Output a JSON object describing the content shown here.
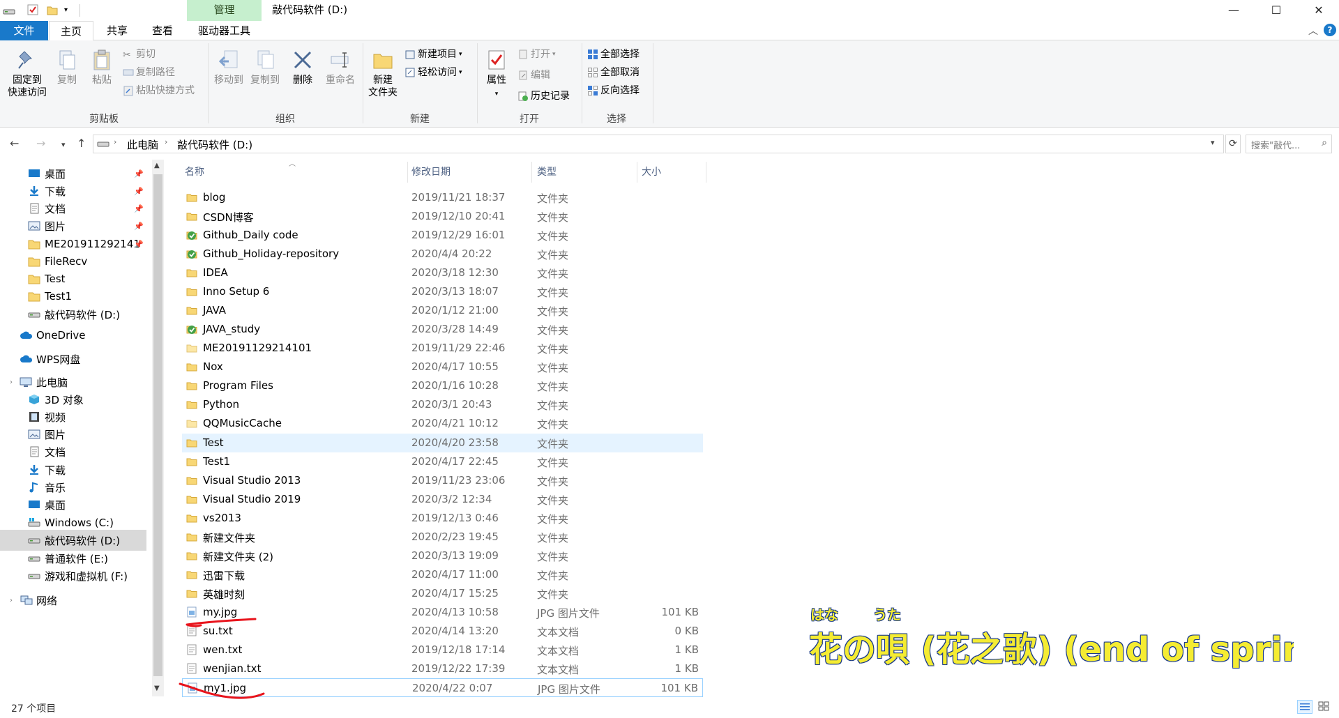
{
  "window": {
    "title": "敲代码软件 (D:)",
    "context_tab": "管理",
    "controls": {
      "minimize": "—",
      "maximize": "☐",
      "close": "✕"
    }
  },
  "tabs": {
    "file": "文件",
    "home": "主页",
    "share": "共享",
    "view": "查看",
    "drive": "驱动器工具"
  },
  "ribbon": {
    "clipboard": {
      "pin_line1": "固定到",
      "pin_line2": "快速访问",
      "copy": "复制",
      "paste": "粘贴",
      "cut": "剪切",
      "copy_path": "复制路径",
      "paste_shortcut": "粘贴快捷方式",
      "label": "剪贴板"
    },
    "organize": {
      "move_to": "移动到",
      "copy_to": "复制到",
      "delete": "删除",
      "rename": "重命名",
      "label": "组织"
    },
    "new": {
      "new_folder_line1": "新建",
      "new_folder_line2": "文件夹",
      "new_item": "新建项目",
      "easy_access": "轻松访问",
      "label": "新建"
    },
    "open": {
      "properties": "属性",
      "open": "打开",
      "edit": "编辑",
      "history": "历史记录",
      "label": "打开"
    },
    "select": {
      "select_all": "全部选择",
      "select_none": "全部取消",
      "invert": "反向选择",
      "label": "选择"
    }
  },
  "address": {
    "crumb1": "此电脑",
    "crumb2": "敲代码软件 (D:)",
    "search_placeholder": "搜索\"敲代..."
  },
  "nav": {
    "items": [
      {
        "label": "桌面",
        "icon": "desktop-icon",
        "pinned": true
      },
      {
        "label": "下载",
        "icon": "download-icon",
        "pinned": true
      },
      {
        "label": "文档",
        "icon": "document-icon",
        "pinned": true
      },
      {
        "label": "图片",
        "icon": "picture-icon",
        "pinned": true
      },
      {
        "label": "ME201911292141",
        "icon": "folder-icon",
        "pinned": true
      },
      {
        "label": "FileRecv",
        "icon": "folder-icon",
        "pinned": false
      },
      {
        "label": "Test",
        "icon": "folder-icon",
        "pinned": false
      },
      {
        "label": "Test1",
        "icon": "folder-icon",
        "pinned": false
      },
      {
        "label": "敲代码软件 (D:)",
        "icon": "drive-icon",
        "pinned": false
      },
      {
        "label": "OneDrive",
        "icon": "cloud-icon",
        "pinned": false
      },
      {
        "label": "WPS网盘",
        "icon": "cloud-icon",
        "pinned": false
      },
      {
        "label": "此电脑",
        "icon": "computer-icon",
        "pinned": false
      },
      {
        "label": "3D 对象",
        "icon": "cube-icon",
        "pinned": false
      },
      {
        "label": "视频",
        "icon": "video-icon",
        "pinned": false
      },
      {
        "label": "图片",
        "icon": "picture-icon",
        "pinned": false
      },
      {
        "label": "文档",
        "icon": "document-icon",
        "pinned": false
      },
      {
        "label": "下载",
        "icon": "download-icon",
        "pinned": false
      },
      {
        "label": "音乐",
        "icon": "music-icon",
        "pinned": false
      },
      {
        "label": "桌面",
        "icon": "desktop-icon",
        "pinned": false
      },
      {
        "label": "Windows (C:)",
        "icon": "windows-drive-icon",
        "pinned": false
      },
      {
        "label": "敲代码软件 (D:)",
        "icon": "drive-icon",
        "pinned": false
      },
      {
        "label": "普通软件 (E:)",
        "icon": "drive-icon",
        "pinned": false
      },
      {
        "label": "游戏和虚拟机 (F:)",
        "icon": "drive-icon",
        "pinned": false
      },
      {
        "label": "网络",
        "icon": "network-icon",
        "pinned": false
      }
    ]
  },
  "columns": {
    "name": "名称",
    "date": "修改日期",
    "type": "类型",
    "size": "大小"
  },
  "files": [
    {
      "name": "blog",
      "date": "2019/11/21 18:37",
      "type": "文件夹",
      "size": "",
      "icon": "folder"
    },
    {
      "name": "CSDN博客",
      "date": "2019/12/10 20:41",
      "type": "文件夹",
      "size": "",
      "icon": "folder"
    },
    {
      "name": "Github_Daily code",
      "date": "2019/12/29 16:01",
      "type": "文件夹",
      "size": "",
      "icon": "git-folder"
    },
    {
      "name": "Github_Holiday-repository",
      "date": "2020/4/4 20:22",
      "type": "文件夹",
      "size": "",
      "icon": "git-folder"
    },
    {
      "name": "IDEA",
      "date": "2020/3/18 12:30",
      "type": "文件夹",
      "size": "",
      "icon": "folder"
    },
    {
      "name": "Inno Setup 6",
      "date": "2020/3/13 18:07",
      "type": "文件夹",
      "size": "",
      "icon": "folder"
    },
    {
      "name": "JAVA",
      "date": "2020/1/12 21:00",
      "type": "文件夹",
      "size": "",
      "icon": "folder"
    },
    {
      "name": "JAVA_study",
      "date": "2020/3/28 14:49",
      "type": "文件夹",
      "size": "",
      "icon": "git-folder"
    },
    {
      "name": "ME20191129214101",
      "date": "2019/11/29 22:46",
      "type": "文件夹",
      "size": "",
      "icon": "folder-empty"
    },
    {
      "name": "Nox",
      "date": "2020/4/17 10:55",
      "type": "文件夹",
      "size": "",
      "icon": "folder"
    },
    {
      "name": "Program Files",
      "date": "2020/1/16 10:28",
      "type": "文件夹",
      "size": "",
      "icon": "folder"
    },
    {
      "name": "Python",
      "date": "2020/3/1 20:43",
      "type": "文件夹",
      "size": "",
      "icon": "folder"
    },
    {
      "name": "QQMusicCache",
      "date": "2020/4/21 10:12",
      "type": "文件夹",
      "size": "",
      "icon": "folder-empty"
    },
    {
      "name": "Test",
      "date": "2020/4/20 23:58",
      "type": "文件夹",
      "size": "",
      "icon": "folder",
      "selected": true
    },
    {
      "name": "Test1",
      "date": "2020/4/17 22:45",
      "type": "文件夹",
      "size": "",
      "icon": "folder"
    },
    {
      "name": "Visual Studio 2013",
      "date": "2019/11/23 23:06",
      "type": "文件夹",
      "size": "",
      "icon": "folder"
    },
    {
      "name": "Visual Studio 2019",
      "date": "2020/3/2 12:34",
      "type": "文件夹",
      "size": "",
      "icon": "folder"
    },
    {
      "name": "vs2013",
      "date": "2019/12/13 0:46",
      "type": "文件夹",
      "size": "",
      "icon": "folder"
    },
    {
      "name": "新建文件夹",
      "date": "2020/2/23 19:45",
      "type": "文件夹",
      "size": "",
      "icon": "folder"
    },
    {
      "name": "新建文件夹 (2)",
      "date": "2020/3/13 19:09",
      "type": "文件夹",
      "size": "",
      "icon": "folder"
    },
    {
      "name": "迅雷下载",
      "date": "2020/4/17 11:00",
      "type": "文件夹",
      "size": "",
      "icon": "folder"
    },
    {
      "name": "英雄时刻",
      "date": "2020/4/17 15:25",
      "type": "文件夹",
      "size": "",
      "icon": "folder"
    },
    {
      "name": "my.jpg",
      "date": "2020/4/13 10:58",
      "type": "JPG 图片文件",
      "size": "101 KB",
      "icon": "image-file"
    },
    {
      "name": "su.txt",
      "date": "2020/4/14 13:20",
      "type": "文本文档",
      "size": "0 KB",
      "icon": "text-file"
    },
    {
      "name": "wen.txt",
      "date": "2019/12/18 17:14",
      "type": "文本文档",
      "size": "1 KB",
      "icon": "text-file"
    },
    {
      "name": "wenjian.txt",
      "date": "2019/12/22 17:39",
      "type": "文本文档",
      "size": "1 KB",
      "icon": "text-file"
    },
    {
      "name": "my1.jpg",
      "date": "2020/4/22 0:07",
      "type": "JPG 图片文件",
      "size": "101 KB",
      "icon": "image-file",
      "focused": true
    }
  ],
  "status": {
    "count": "27 个项目"
  },
  "overlay": {
    "lyric": "花の唄 (花之歌) (end of spring ve",
    "furigana1": "はな",
    "furigana2": "うた"
  },
  "colors": {
    "accent": "#1979ca",
    "folder": "#f8d775",
    "context_tab": "#c6efce",
    "selection": "#e5f3ff",
    "annotation_red": "#e8141c",
    "lyric_fill": "#f5ec32"
  }
}
